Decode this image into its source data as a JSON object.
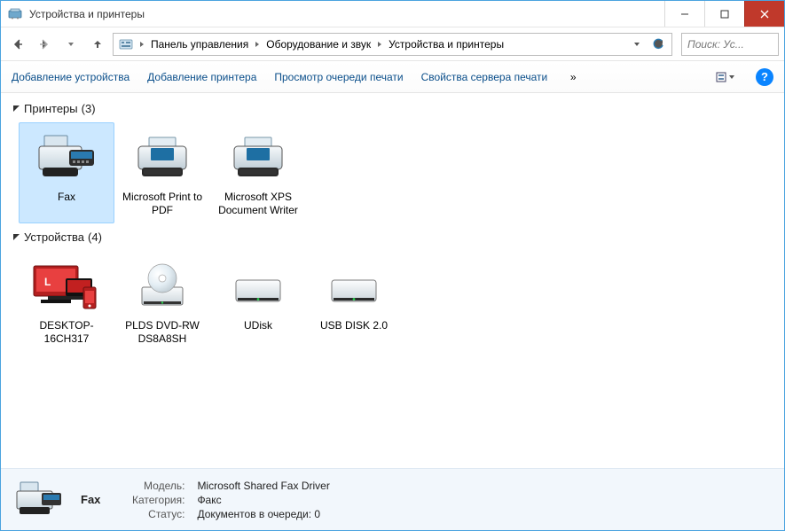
{
  "window": {
    "title": "Устройства и принтеры"
  },
  "breadcrumb": {
    "items": [
      "Панель управления",
      "Оборудование и звук",
      "Устройства и принтеры"
    ]
  },
  "search": {
    "placeholder": "Поиск: Ус..."
  },
  "toolbar": {
    "items": [
      "Добавление устройства",
      "Добавление принтера",
      "Просмотр очереди печати",
      "Свойства сервера печати"
    ],
    "overflow": "»"
  },
  "groups": [
    {
      "title": "Принтеры",
      "display_count": "(3)",
      "items": [
        {
          "label": "Fax",
          "icon": "fax",
          "selected": true
        },
        {
          "label": "Microsoft Print to PDF",
          "icon": "printer"
        },
        {
          "label": "Microsoft XPS Document Writer",
          "icon": "printer"
        }
      ]
    },
    {
      "title": "Устройства",
      "display_count": "(4)",
      "items": [
        {
          "label": "DESKTOP-16CH317",
          "icon": "desktop-red"
        },
        {
          "label": "PLDS DVD-RW DS8A8SH",
          "icon": "dvd"
        },
        {
          "label": "UDisk",
          "icon": "drive"
        },
        {
          "label": "USB DISK 2.0",
          "icon": "drive"
        }
      ]
    }
  ],
  "details": {
    "name": "Fax",
    "rows": [
      {
        "k": "Модель:",
        "v": "Microsoft Shared Fax Driver"
      },
      {
        "k": "Категория:",
        "v": "Факс"
      },
      {
        "k": "Статус:",
        "v": "Документов в очереди: 0"
      }
    ]
  }
}
